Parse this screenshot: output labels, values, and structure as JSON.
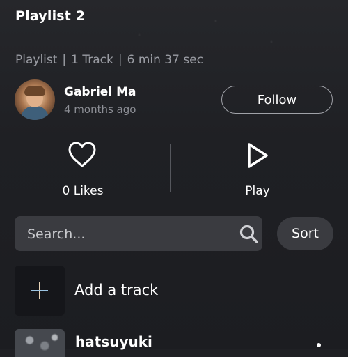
{
  "header": {
    "title": "Playlist 2"
  },
  "meta": {
    "type": "Playlist",
    "tracks": "1 Track",
    "duration": "6 min 37 sec",
    "separator": "|"
  },
  "owner": {
    "name": "Gabriel Ma",
    "posted": "4 months ago",
    "follow_label": "Follow"
  },
  "actions": {
    "likes_label": "0 Likes",
    "play_label": "Play"
  },
  "search": {
    "placeholder": "Search...",
    "sort_label": "Sort"
  },
  "add_track": {
    "label": "Add a track"
  },
  "tracks": [
    {
      "title": "hatsuyuki"
    }
  ],
  "colors": {
    "background": "#1f2024",
    "field": "#3a3b40",
    "muted_text": "#9a9ca3"
  }
}
